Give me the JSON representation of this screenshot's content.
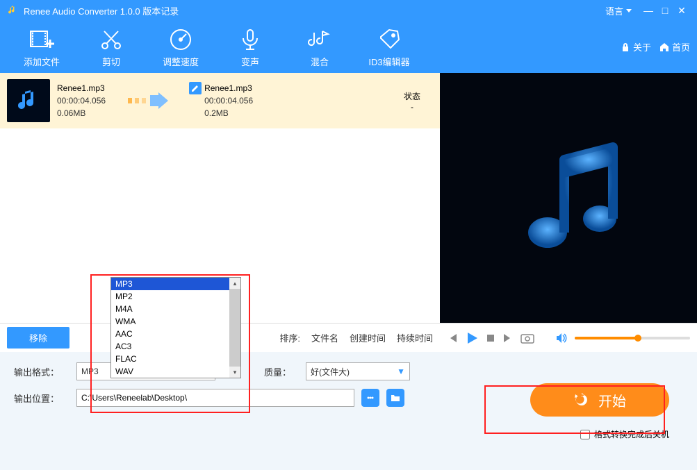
{
  "titlebar": {
    "title": "Renee Audio Converter 1.0.0 版本记录",
    "language_label": "语言"
  },
  "toolbar": {
    "items": [
      {
        "label": "添加文件"
      },
      {
        "label": "剪切"
      },
      {
        "label": "调整速度"
      },
      {
        "label": "变声"
      },
      {
        "label": "混合"
      },
      {
        "label": "ID3编辑器"
      }
    ],
    "about": "关于",
    "home": "首页"
  },
  "file_row": {
    "src_name": "Renee1.mp3",
    "src_dur": "00:00:04.056",
    "src_size": "0.06MB",
    "out_name": "Renee1.mp3",
    "out_dur": "00:00:04.056",
    "out_size": "0.2MB",
    "status_label": "状态",
    "status_value": "-"
  },
  "controls": {
    "remove": "移除",
    "sort_label": "排序:",
    "sort_filename": "文件名",
    "sort_created": "创建时间",
    "sort_duration": "持续时间"
  },
  "bottom": {
    "format_label": "输出格式：",
    "format_value": "MP3",
    "format_options": [
      "MP3",
      "MP2",
      "M4A",
      "WMA",
      "AAC",
      "AC3",
      "FLAC",
      "WAV"
    ],
    "quality_label": "质量：",
    "quality_value": "好(文件大)",
    "location_label": "输出位置：",
    "location_value": "C:\\Users\\Reneelab\\Desktop\\",
    "start": "开始",
    "shutdown_after": "格式转换完成后关机"
  }
}
